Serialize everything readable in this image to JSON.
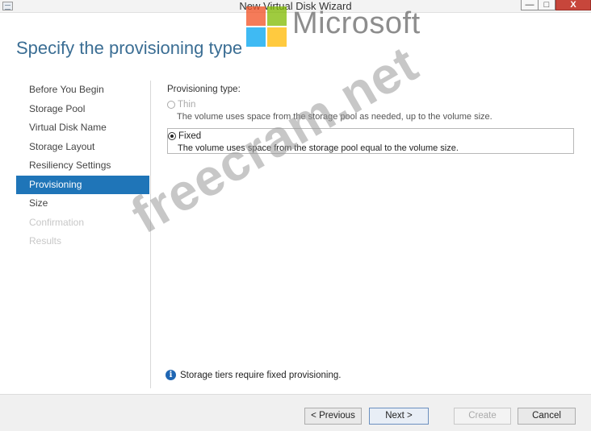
{
  "window": {
    "title": "New Virtual Disk Wizard",
    "min_glyph": "—",
    "max_glyph": "□",
    "close_glyph": "X"
  },
  "watermarks": {
    "microsoft": "Microsoft",
    "site": "freecram.net"
  },
  "heading": "Specify the provisioning type",
  "nav": {
    "items": [
      {
        "label": "Before You Begin",
        "state": "normal"
      },
      {
        "label": "Storage Pool",
        "state": "normal"
      },
      {
        "label": "Virtual Disk Name",
        "state": "normal"
      },
      {
        "label": "Storage Layout",
        "state": "normal"
      },
      {
        "label": "Resiliency Settings",
        "state": "normal"
      },
      {
        "label": "Provisioning",
        "state": "active"
      },
      {
        "label": "Size",
        "state": "normal"
      },
      {
        "label": "Confirmation",
        "state": "disabled"
      },
      {
        "label": "Results",
        "state": "disabled"
      }
    ]
  },
  "provisioning": {
    "label": "Provisioning type:",
    "options": [
      {
        "label": "Thin",
        "desc": "The volume uses space from the storage pool as needed, up to the volume size.",
        "checked": false,
        "enabled": false
      },
      {
        "label": "Fixed",
        "desc": "The volume uses space from the storage pool equal to the volume size.",
        "checked": true,
        "enabled": true
      }
    ]
  },
  "note": {
    "icon": "info-icon",
    "text": "Storage tiers require fixed provisioning."
  },
  "buttons": {
    "previous": "< Previous",
    "next": "Next >",
    "create": "Create",
    "cancel": "Cancel"
  },
  "colors": {
    "accent": "#1f75b8",
    "heading": "#3b6e94",
    "close": "#c7463b"
  }
}
